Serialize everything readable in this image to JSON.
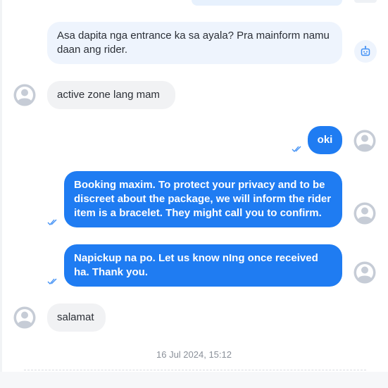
{
  "messages": [
    {
      "sender": "bot",
      "text": "Asa dapita nga entrance ka sa ayala? Pra mainform namu daan ang rider."
    },
    {
      "sender": "customer",
      "text": "active zone lang mam"
    },
    {
      "sender": "agent",
      "text": "oki"
    },
    {
      "sender": "agent",
      "text": "Booking maxim. To protect your privacy and to be discreet about the package, we will inform the rider item is a bracelet. They might call you to confirm."
    },
    {
      "sender": "agent",
      "text": "Napickup na po. Let us know nIng once received ha. Thank you."
    },
    {
      "sender": "customer",
      "text": "salamat"
    }
  ],
  "date_separator": "16 Jul 2024, 15:12",
  "icons": {
    "bot": "robot-icon",
    "avatar": "user-avatar-icon",
    "read_receipt": "double-check-icon"
  },
  "colors": {
    "outgoing_bubble": "#1f7cf2",
    "incoming_bubble": "#f1f2f4",
    "bot_bubble": "#eef4fd",
    "read_tick": "#3d8ef5"
  }
}
